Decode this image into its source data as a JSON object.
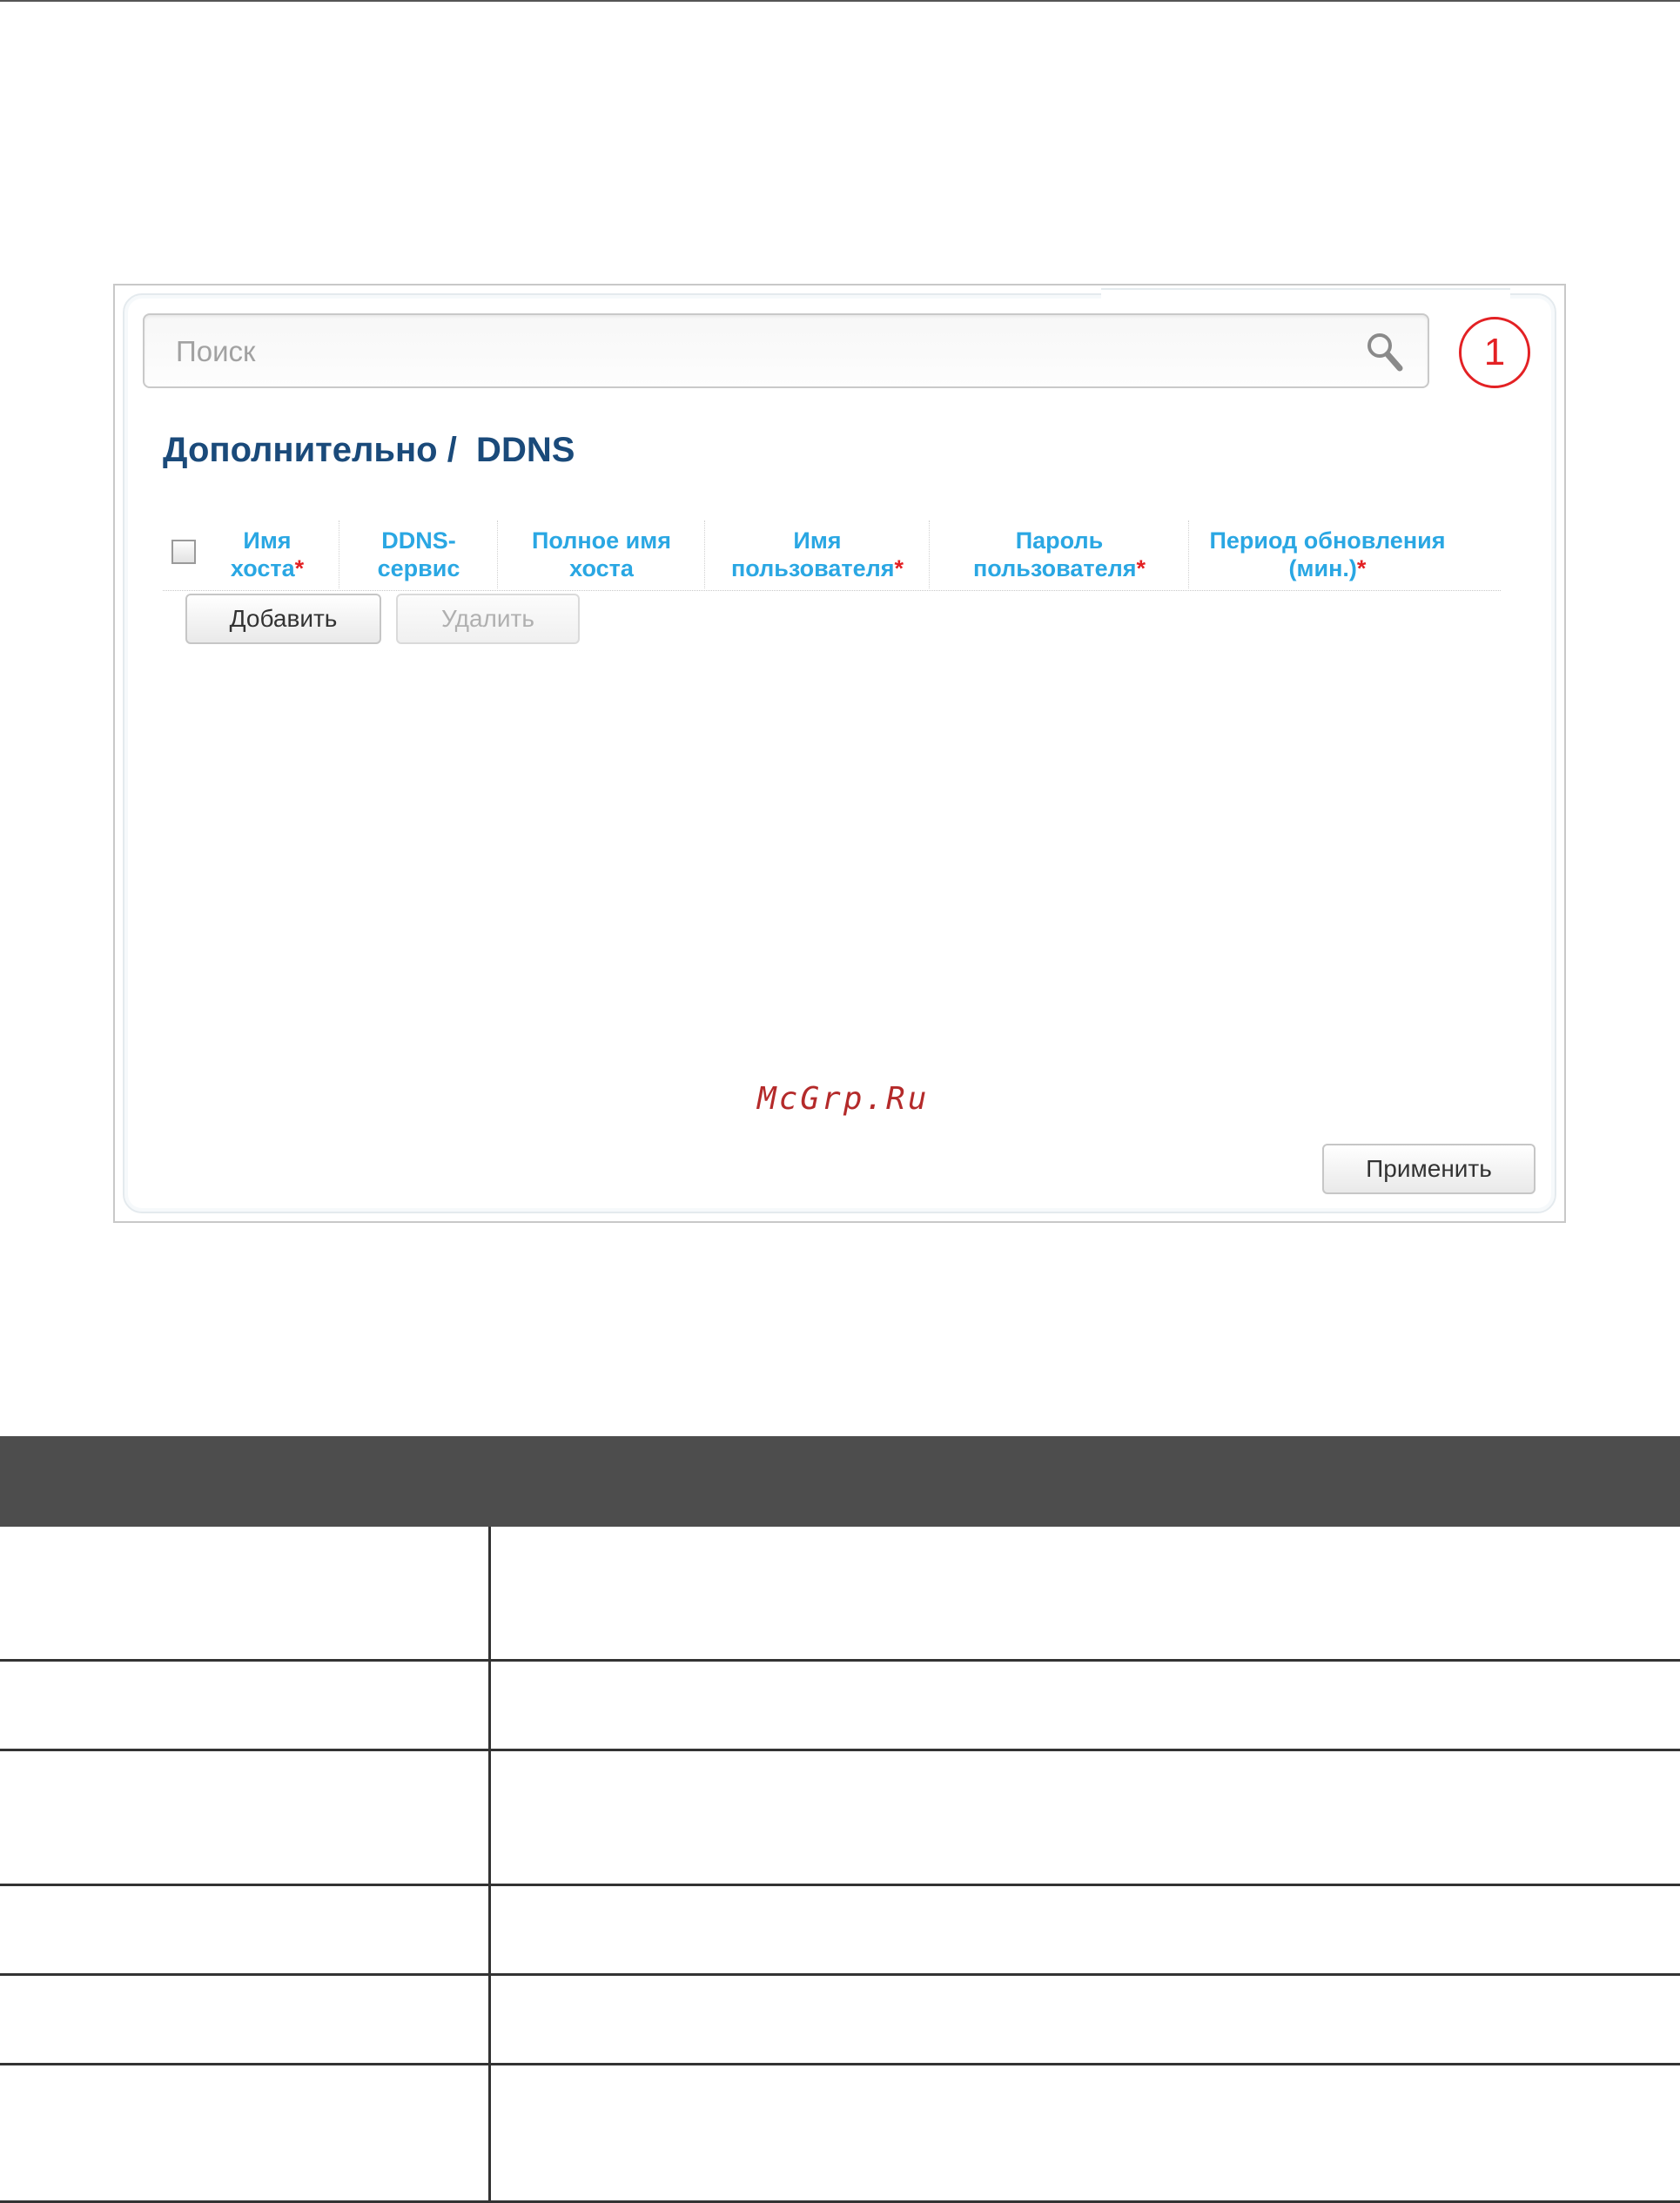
{
  "search": {
    "placeholder": "Поиск"
  },
  "badge": {
    "number": "1"
  },
  "page": {
    "title": "Дополнительно /  DDNS"
  },
  "table": {
    "columns": [
      {
        "line1": "Имя",
        "line2": "хоста",
        "required": "*"
      },
      {
        "line1": "DDNS-",
        "line2": "сервис",
        "required": ""
      },
      {
        "line1": "Полное имя",
        "line2": "хоста",
        "required": ""
      },
      {
        "line1": "Имя",
        "line2": "пользователя",
        "required": "*"
      },
      {
        "line1": "Пароль",
        "line2": "пользователя",
        "required": "*"
      },
      {
        "line1": "Период обновления",
        "line2": "(мин.)",
        "required": "*"
      }
    ]
  },
  "buttons": {
    "add": "Добавить",
    "delete": "Удалить",
    "apply": "Применить"
  },
  "watermark": "McGrp.Ru",
  "colors": {
    "accent": "#2aa7e3",
    "title": "#1a4a7a",
    "required": "#e32124",
    "header_bar": "#4d4d4d"
  }
}
